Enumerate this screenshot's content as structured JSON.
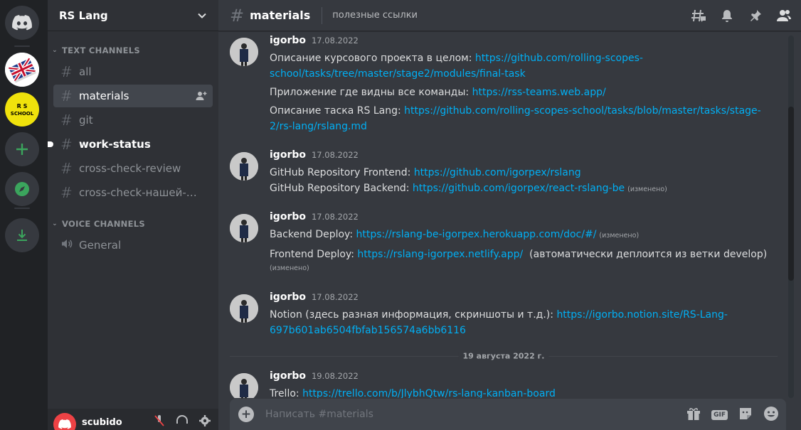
{
  "colors": {
    "accent_green": "#3ba55d",
    "link": "#00aff4",
    "brand_red": "#ed4245"
  },
  "guilds": [
    {
      "name": "discord-home",
      "icon": "discord-logo-icon"
    },
    {
      "name": "rs-lang",
      "icon": "uk-flag-book-icon"
    },
    {
      "name": "rs-school",
      "icon": "rs-school-logo",
      "text": "RS SCHOOL"
    },
    {
      "name": "add-server",
      "icon": "plus-icon"
    },
    {
      "name": "explore",
      "icon": "compass-icon"
    },
    {
      "name": "download-apps",
      "icon": "download-icon"
    }
  ],
  "server": {
    "name": "RS Lang"
  },
  "categories": {
    "text": "TEXT CHANNELS",
    "voice": "VOICE CHANNELS"
  },
  "channels": [
    {
      "label": "all"
    },
    {
      "label": "materials"
    },
    {
      "label": "git"
    },
    {
      "label": "work-status"
    },
    {
      "label": "cross-check-review"
    },
    {
      "label": "cross-check-нашей-ра..."
    }
  ],
  "voice_channels": [
    {
      "label": "General"
    }
  ],
  "user": {
    "name": "scubido"
  },
  "header": {
    "channel": "materials",
    "topic": "полезные ссылки"
  },
  "messages": [
    {
      "author": "igorbo",
      "date": "17.08.2022",
      "lines": [
        {
          "text": "Описание курсового проекта в целом: ",
          "link": "https://github.com/rolling-scopes-"
        },
        {
          "link": "school/tasks/tree/master/stage2/modules/final-task"
        },
        {
          "text": "Приложение где видны все команды: ",
          "link": "https://rss-teams.web.app/"
        },
        {
          "text": "Описание таска RS Lang: ",
          "link": "https://github.com/rolling-scopes-school/tasks/blob/master/tasks/stage-"
        },
        {
          "link": "2/rs-lang/rslang.md"
        }
      ]
    },
    {
      "author": "igorbo",
      "date": "17.08.2022",
      "lines": [
        {
          "text": "GitHub Repository Frontend: ",
          "link": "https://github.com/igorpex/rslang"
        },
        {
          "text": "GitHub Repository Backend: ",
          "link": "https://github.com/igorpex/react-rslang-be",
          "edited": "(изменено)"
        }
      ]
    },
    {
      "author": "igorbo",
      "date": "17.08.2022",
      "lines": [
        {
          "text": "Backend Deploy: ",
          "link": "https://rslang-be-igorpex.herokuapp.com/doc/#/",
          "edited": "(изменено)"
        },
        {
          "text": "Frontend Deploy: ",
          "link": "https://rslang-igorpex.netlify.app/",
          "after": "  (автоматически деплоится из ветки develop)"
        },
        {
          "edited": "(изменено)"
        }
      ]
    },
    {
      "author": "igorbo",
      "date": "17.08.2022",
      "lines": [
        {
          "text": "Notion (здесь разная информация, скриншоты и т.д.): ",
          "link": "https://igorbo.notion.site/RS-Lang-"
        },
        {
          "link": "697b601ab6504fbfab156574a6bb6116"
        }
      ]
    },
    {
      "author": "igorbo",
      "date": "19.08.2022",
      "lines": [
        {
          "text": "Trello: ",
          "link": "https://trello.com/b/JlybhQtw/rs-lang-kanban-board"
        }
      ]
    }
  ],
  "date_divider": "19 августа 2022 г.",
  "composer": {
    "placeholder": "Написать #materials",
    "gif_label": "GIF"
  }
}
